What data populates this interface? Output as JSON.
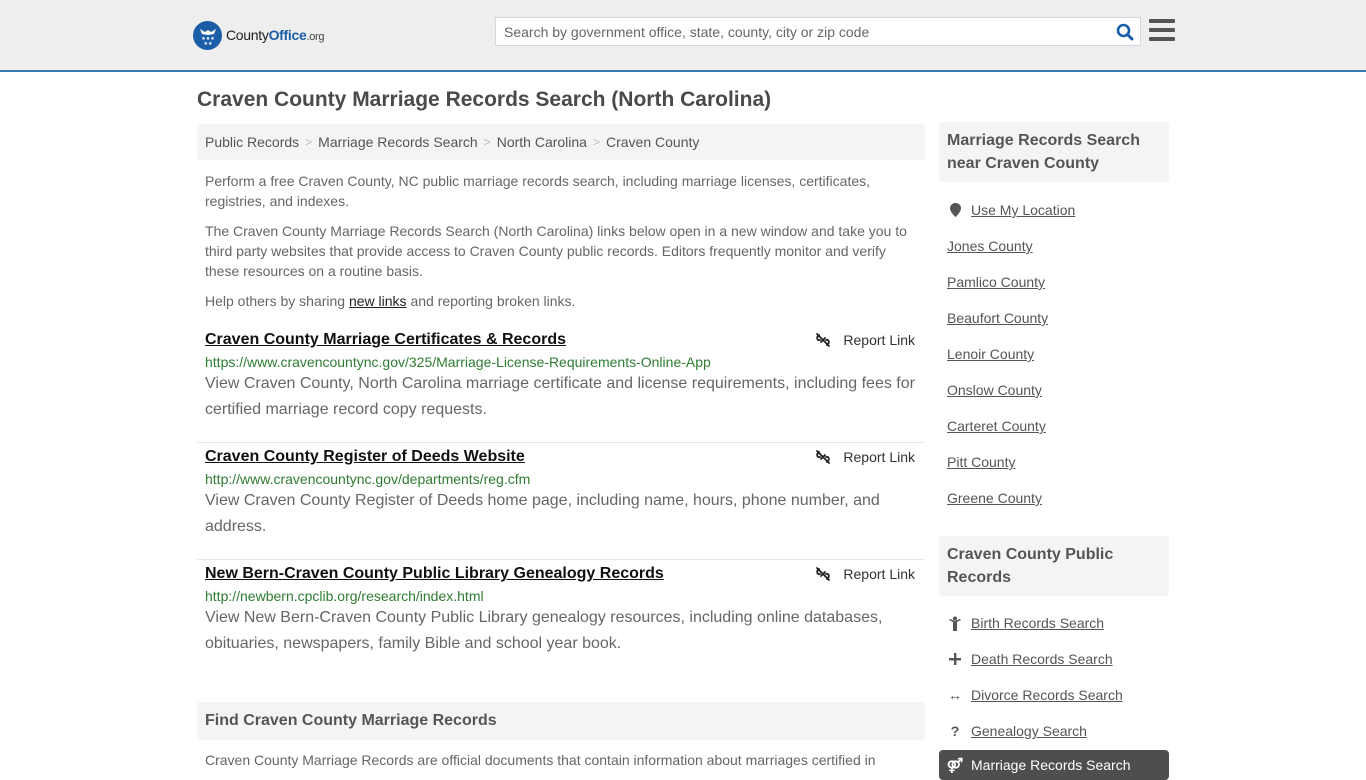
{
  "header": {
    "logo": {
      "name": "County",
      "highlight": "Office",
      "suffix": ".org"
    },
    "search": {
      "placeholder": "Search by government office, state, county, city or zip code",
      "value": ""
    },
    "search_icon": "search-icon",
    "menu_icon": "hamburger-menu-icon"
  },
  "page": {
    "title": "Craven County Marriage Records Search (North Carolina)",
    "breadcrumb": [
      "Public Records",
      "Marriage Records Search",
      "North Carolina",
      "Craven County"
    ],
    "intro": {
      "p1": "Perform a free Craven County, NC public marriage records search, including marriage licenses, certificates, registries, and indexes.",
      "p2": "The Craven County Marriage Records Search (North Carolina) links below open in a new window and take you to third party websites that provide access to Craven County public records. Editors frequently monitor and verify these resources on a routine basis.",
      "p3_before": "Help others by sharing ",
      "p3_link": "new links",
      "p3_after": " and reporting broken links."
    },
    "report_label": "Report Link",
    "results": [
      {
        "title": "Craven County Marriage Certificates & Records",
        "url": "https://www.cravencountync.gov/325/Marriage-License-Requirements-Online-App",
        "description": "View Craven County, North Carolina marriage certificate and license requirements, including fees for certified marriage record copy requests."
      },
      {
        "title": "Craven County Register of Deeds Website",
        "url": "http://www.cravencountync.gov/departments/reg.cfm",
        "description": "View Craven County Register of Deeds home page, including name, hours, phone number, and address."
      },
      {
        "title": "New Bern-Craven County Public Library Genealogy Records",
        "url": "http://newbern.cpclib.org/research/index.html",
        "description": "View New Bern-Craven County Public Library genealogy resources, including online databases, obituaries, newspapers, family Bible and school year book."
      }
    ],
    "find": {
      "heading": "Find Craven County Marriage Records",
      "text": "Craven County Marriage Records are official documents that contain information about marriages certified in"
    }
  },
  "sidebar": {
    "nearby": {
      "heading": "Marriage Records Search near Craven County",
      "use_location": "Use My Location",
      "counties": [
        "Jones County",
        "Pamlico County",
        "Beaufort County",
        "Lenoir County",
        "Onslow County",
        "Carteret County",
        "Pitt County",
        "Greene County"
      ]
    },
    "public_records": {
      "heading": "Craven County Public Records",
      "items": [
        {
          "label": "Birth Records Search",
          "icon": "child-icon"
        },
        {
          "label": "Death Records Search",
          "icon": "cross-icon"
        },
        {
          "label": "Divorce Records Search",
          "icon": "arrows-horizontal-icon"
        },
        {
          "label": "Genealogy Search",
          "icon": "question-icon"
        },
        {
          "label": "Marriage Records Search",
          "icon": "marriage-icon",
          "active": true
        }
      ]
    }
  },
  "colors": {
    "brand_blue": "#1a5ea8",
    "header_border": "#3a7bac",
    "url_green": "#2e7d32",
    "active_bg": "#4e4e4e"
  }
}
